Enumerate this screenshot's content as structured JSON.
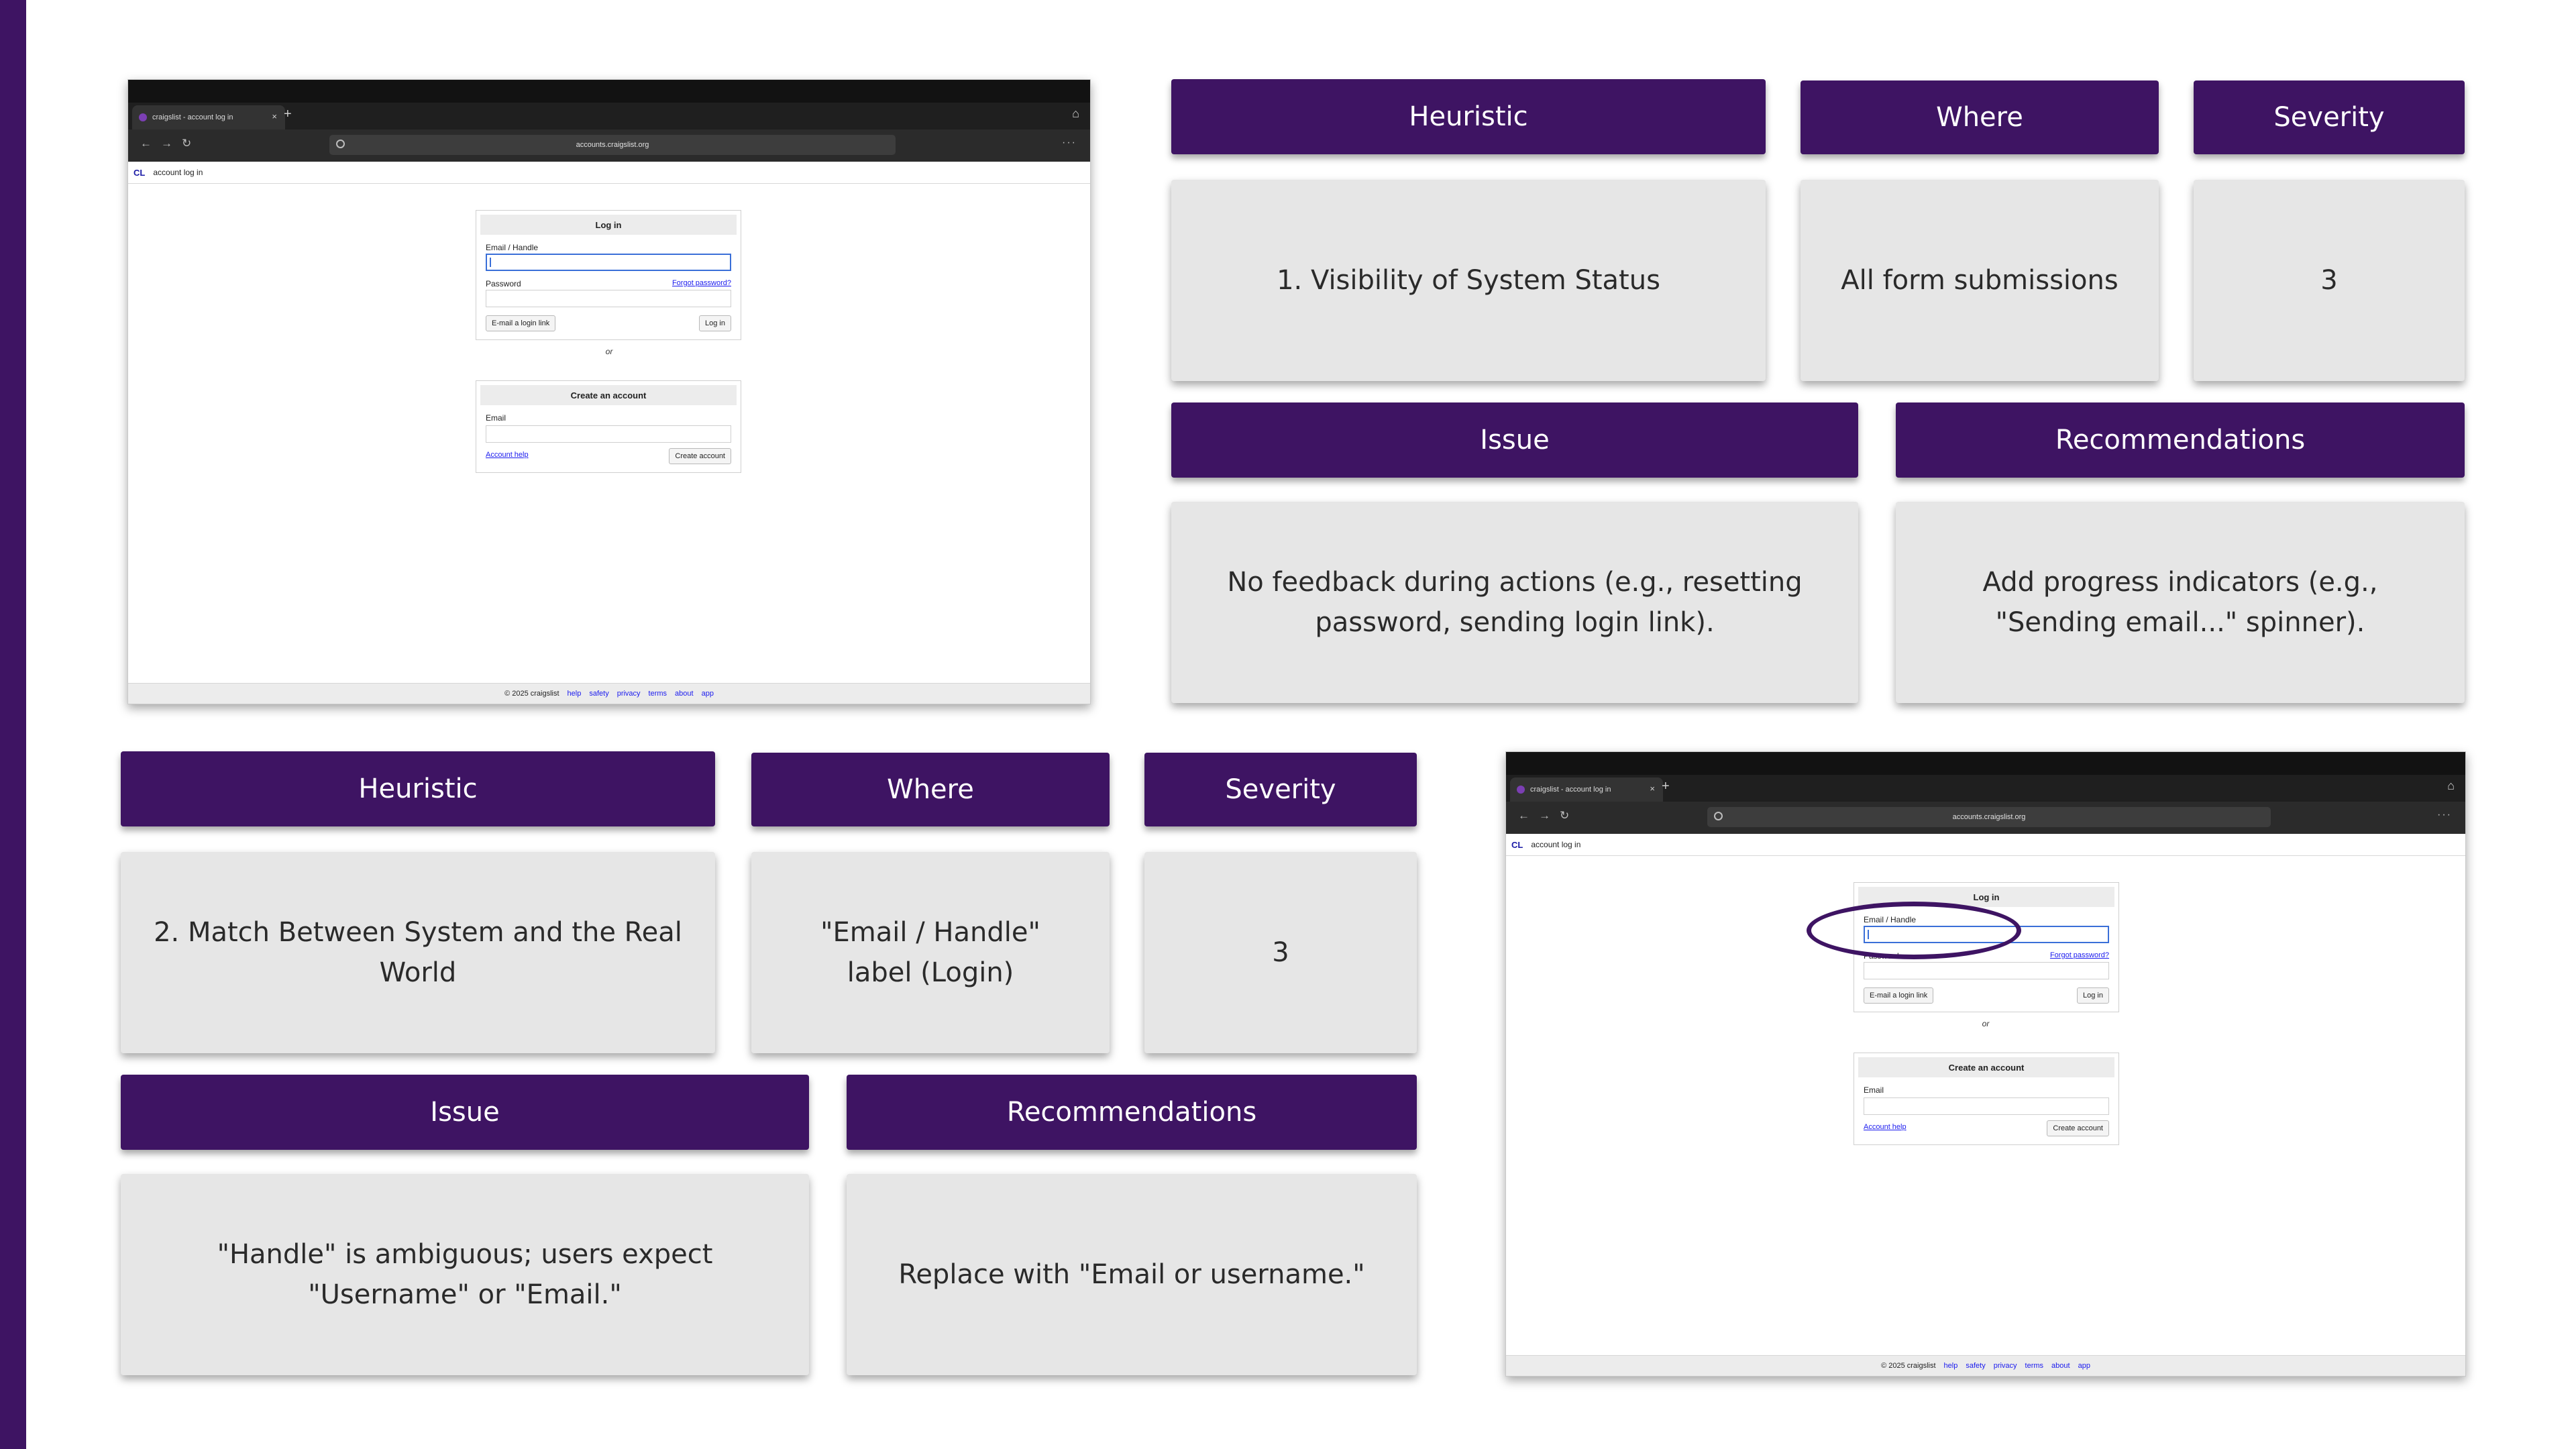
{
  "screenshot": {
    "tab_title": "craigslist - account log in",
    "url": "accounts.craigslist.org",
    "logo": "CL",
    "page_heading": "account log in",
    "login_box": {
      "title": "Log in",
      "email_label": "Email / Handle",
      "password_label": "Password",
      "forgot_link": "Forgot password?",
      "email_link_button": "E-mail a login link",
      "login_button": "Log in"
    },
    "or_text": "or",
    "create_box": {
      "title": "Create an account",
      "email_label": "Email",
      "help_link": "Account help",
      "create_button": "Create account"
    },
    "footer": {
      "copyright": "© 2025 craigslist",
      "links": [
        "help",
        "safety",
        "privacy",
        "terms",
        "about",
        "app"
      ]
    }
  },
  "headers": {
    "heuristic": "Heuristic",
    "where": "Where",
    "severity": "Severity",
    "issue": "Issue",
    "recommendations": "Recommendations"
  },
  "findings": [
    {
      "heuristic": "1. Visibility of System Status",
      "where": "All form submissions",
      "severity": "3",
      "issue": "No feedback during actions (e.g., resetting password, sending login link).",
      "recommendation": "Add progress indicators (e.g., \"Sending email...\" spinner)."
    },
    {
      "heuristic": "2. Match Between System and the Real World",
      "where": "\"Email / Handle\" label (Login)",
      "severity": "3",
      "issue": "\"Handle\" is ambiguous; users expect \"Username\" or \"Email.\"",
      "recommendation": "Replace with \"Email or username.\""
    }
  ],
  "colors": {
    "accent": "#3e1463",
    "card_bg": "#e6e6e6",
    "link": "#1a1aee"
  }
}
